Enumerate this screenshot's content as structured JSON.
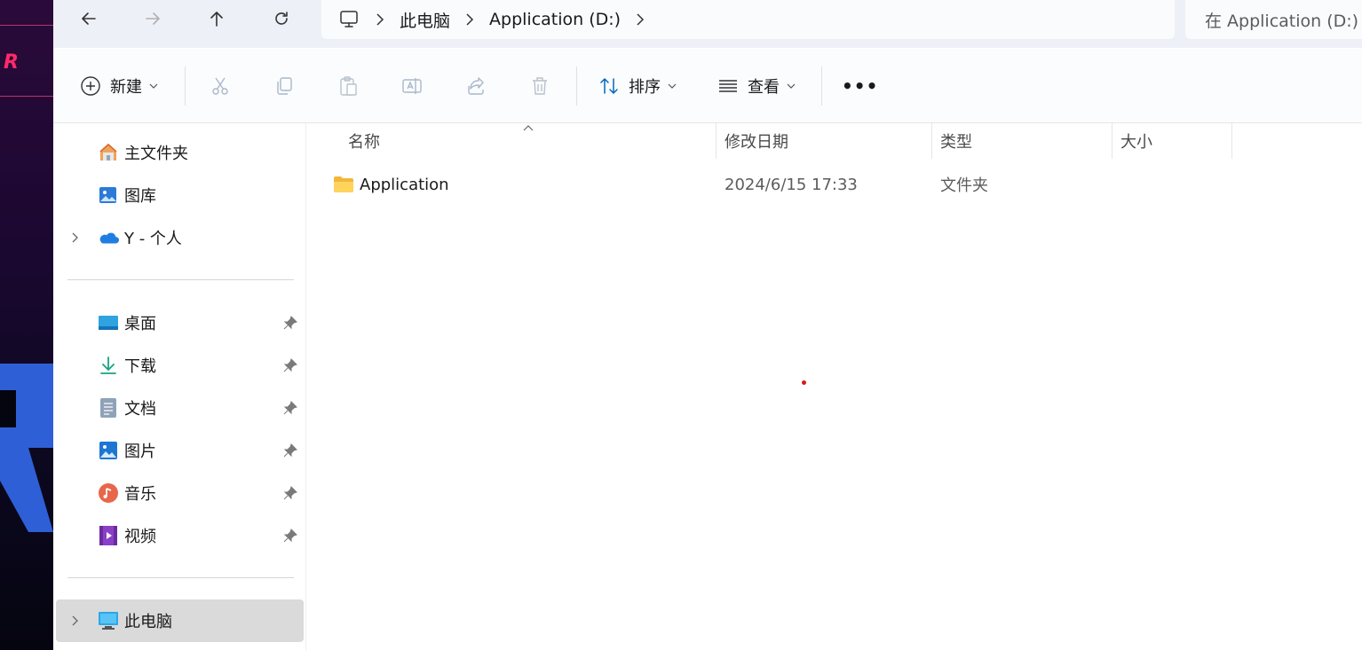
{
  "address": {
    "crumbs": [
      "此电脑",
      "Application (D:)"
    ]
  },
  "search": {
    "placeholder": "在 Application (D:)"
  },
  "commands": {
    "new_label": "新建",
    "sort_label": "排序",
    "view_label": "查看",
    "more_label": "•••"
  },
  "sidebar": {
    "top_items": [
      {
        "label": "主文件夹",
        "icon": "home-icon"
      },
      {
        "label": "图库",
        "icon": "gallery-icon"
      },
      {
        "label": "Y - 个人",
        "icon": "onedrive-icon"
      }
    ],
    "pinned_items": [
      {
        "label": "桌面",
        "icon": "desktop-icon"
      },
      {
        "label": "下载",
        "icon": "download-icon"
      },
      {
        "label": "文档",
        "icon": "documents-icon"
      },
      {
        "label": "图片",
        "icon": "pictures-icon"
      },
      {
        "label": "音乐",
        "icon": "music-icon"
      },
      {
        "label": "视频",
        "icon": "videos-icon"
      }
    ],
    "this_pc_label": "此电脑"
  },
  "columns": {
    "name": "名称",
    "modified": "修改日期",
    "type": "类型",
    "size": "大小"
  },
  "files": [
    {
      "name": "Application",
      "modified": "2024/6/15 17:33",
      "type": "文件夹",
      "size": ""
    }
  ],
  "colors": {
    "accent": "#0067c0",
    "folder": "#f8c84a",
    "selected": "#dadada"
  }
}
